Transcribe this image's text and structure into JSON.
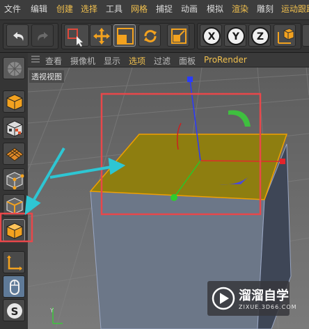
{
  "menubar": {
    "items": [
      {
        "label": "文件",
        "highlight": false
      },
      {
        "label": "编辑",
        "highlight": false
      },
      {
        "label": "创建",
        "highlight": true
      },
      {
        "label": "选择",
        "highlight": true
      },
      {
        "label": "工具",
        "highlight": false
      },
      {
        "label": "网格",
        "highlight": true
      },
      {
        "label": "捕捉",
        "highlight": false
      },
      {
        "label": "动画",
        "highlight": false
      },
      {
        "label": "模拟",
        "highlight": false
      },
      {
        "label": "渲染",
        "highlight": true
      },
      {
        "label": "雕刻",
        "highlight": false
      },
      {
        "label": "运动跟踪",
        "highlight": true
      }
    ]
  },
  "toolbar": {
    "buttons": [
      "undo-icon",
      "redo-icon",
      "select-icon",
      "move-icon",
      "scale-icon",
      "rotate-icon",
      "last-tool-icon"
    ],
    "axes": [
      "X",
      "Y",
      "Z"
    ]
  },
  "viewport_menu": {
    "items": [
      {
        "label": "查看",
        "highlight": false
      },
      {
        "label": "摄像机",
        "highlight": false
      },
      {
        "label": "显示",
        "highlight": false
      },
      {
        "label": "选项",
        "highlight": true
      },
      {
        "label": "过滤",
        "highlight": false
      },
      {
        "label": "面板",
        "highlight": false
      },
      {
        "label": "ProRender",
        "highlight": true
      }
    ]
  },
  "viewport": {
    "title": "透视视图"
  },
  "left_tools": [
    "make-editable-icon",
    "model-mode-icon",
    "texture-mode-icon",
    "workplane-icon",
    "point-mode-icon",
    "edge-mode-icon",
    "polygon-mode-icon",
    "axis-icon",
    "mouse-tweak-icon",
    "snap-icon"
  ],
  "watermark": {
    "name": "溜溜自学",
    "url": "ZIXUE.3D66.COM"
  },
  "colors": {
    "polygon_fill": "#8e7e10",
    "selection_highlight": "#e8474a",
    "arrow": "#2ec6d3",
    "menu_highlight": "#f2c14e"
  }
}
